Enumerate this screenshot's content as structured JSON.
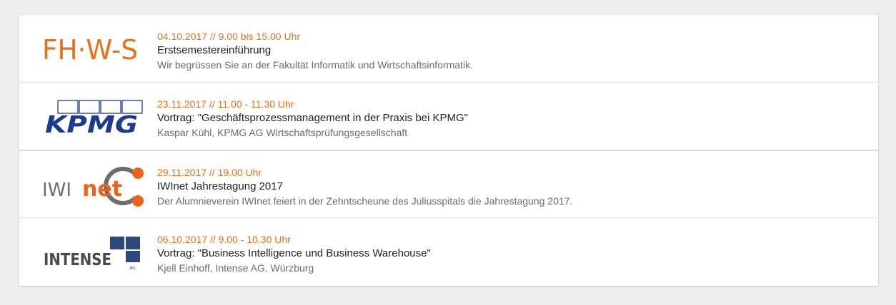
{
  "events": [
    {
      "logo": "fhws-logo",
      "logo_text": "FH·W-S",
      "date": "04.10.2017 // 9.00 bis 15.00 Uhr",
      "title": "Erstsemestereinführung",
      "description": "Wir begrüssen Sie an der Fakultät Informatik und Wirtschaftsinformatik."
    },
    {
      "logo": "kpmg-logo",
      "logo_text": "KPMG",
      "date": "23.11.2017 // 11.00 - 11.30 Uhr",
      "title": "Vortrag: \"Geschäftsprozessmanagement in der Praxis bei KPMG\"",
      "description": "Kaspar Kühl, KPMG AG Wirtschaftsprüfungsgesellschaft"
    },
    {
      "logo": "iwinet-logo",
      "logo_text_a": "IWI",
      "logo_text_b": "net",
      "date": "29.11.2017 // 19.00 Uhr",
      "title": "IWInet Jahrestagung 2017",
      "description": "Der Alumnieverein IWInet feiert in der Zehntscheune des Juliusspitals die Jahrestagung 2017."
    },
    {
      "logo": "intense-logo",
      "logo_text": "INTENSE",
      "logo_suffix": "AG",
      "date": "06.10.2017 // 9.00 - 10.30 Uhr",
      "title": "Vortrag: \"Business Intelligence und Business Warehouse\"",
      "description": "Kjell Einhoff, Intense AG, Würzburg"
    }
  ],
  "colors": {
    "accent": "#e5711c",
    "kpmg_blue": "#1b3c8c",
    "intense_blue": "#2b4a7a",
    "iwinet_grey": "#6d6d6d",
    "iwinet_orange": "#e8641c"
  }
}
